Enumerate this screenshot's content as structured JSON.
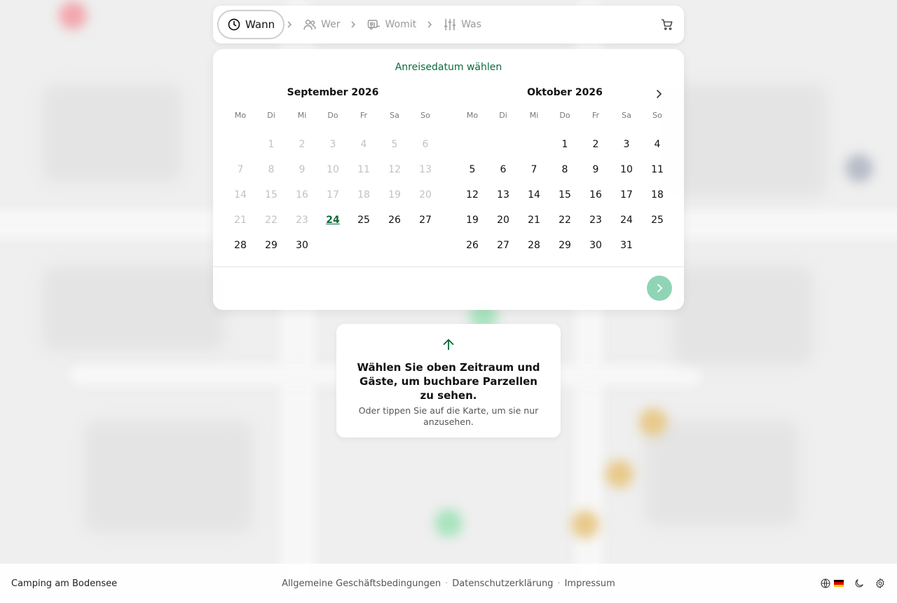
{
  "steps": [
    {
      "label": "Wann",
      "icon": "clock-icon"
    },
    {
      "label": "Wer",
      "icon": "users-icon"
    },
    {
      "label": "Womit",
      "icon": "caravan-icon"
    },
    {
      "label": "Was",
      "icon": "sliders-icon"
    }
  ],
  "calendar": {
    "title": "Anreisedatum wählen",
    "weekdays": [
      "Mo",
      "Di",
      "Mi",
      "Do",
      "Fr",
      "Sa",
      "So"
    ],
    "months": [
      {
        "name": "September 2026",
        "weeks": [
          [
            "",
            "1",
            "2",
            "3",
            "4",
            "5",
            "6"
          ],
          [
            "7",
            "8",
            "9",
            "10",
            "11",
            "12",
            "13"
          ],
          [
            "14",
            "15",
            "16",
            "17",
            "18",
            "19",
            "20"
          ],
          [
            "21",
            "22",
            "23",
            "24",
            "25",
            "26",
            "27"
          ],
          [
            "28",
            "29",
            "30",
            "",
            "",
            "",
            ""
          ]
        ],
        "disabled_until": 23,
        "today": "24"
      },
      {
        "name": "Oktober 2026",
        "weeks": [
          [
            "",
            "",
            "",
            "1",
            "2",
            "3",
            "4"
          ],
          [
            "5",
            "6",
            "7",
            "8",
            "9",
            "10",
            "11"
          ],
          [
            "12",
            "13",
            "14",
            "15",
            "16",
            "17",
            "18"
          ],
          [
            "19",
            "20",
            "21",
            "22",
            "23",
            "24",
            "25"
          ],
          [
            "26",
            "27",
            "28",
            "29",
            "30",
            "31",
            ""
          ]
        ],
        "disabled_until": 0,
        "today": ""
      }
    ]
  },
  "hint": {
    "title": "Wählen Sie oben Zeitraum und Gäste, um buchbare Parzellen zu sehen.",
    "subtitle": "Oder tippen Sie auf die Karte, um sie nur anzusehen."
  },
  "footer": {
    "site_name": "Camping am Bodensee",
    "links": [
      "Allgemeine Geschäftsbedingungen",
      "Datenschutzerklärung",
      "Impressum"
    ],
    "separator": "·"
  },
  "colors": {
    "accent": "#0a6b3a",
    "next_button": "#90d4b6"
  }
}
